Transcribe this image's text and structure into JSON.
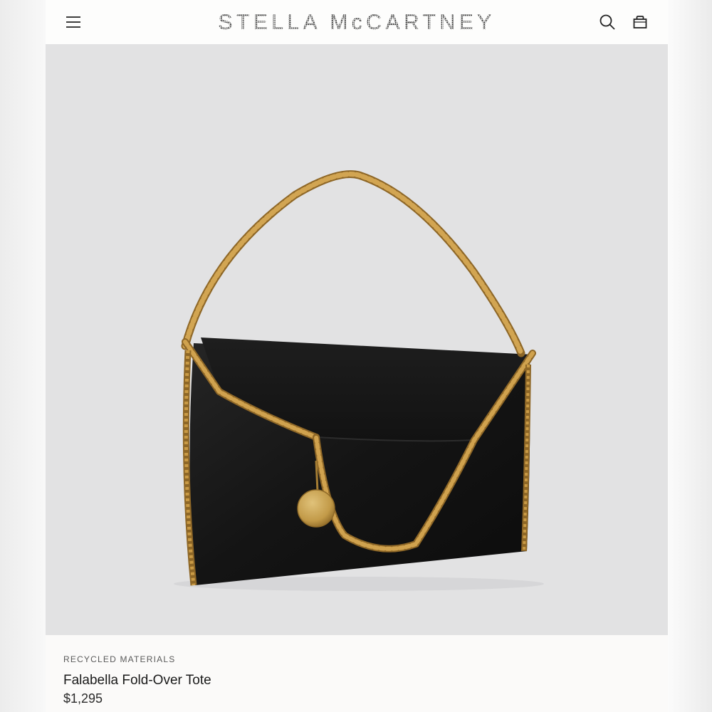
{
  "header": {
    "brand": "STELLA McCARTNEY",
    "menu_icon": "hamburger-menu-icon",
    "search_icon": "search-icon",
    "bag_icon": "shopping-bag-icon"
  },
  "product": {
    "tag": "RECYCLED MATERIALS",
    "name": "Falabella Fold-Over Tote",
    "price": "$1,295",
    "image": "black-fold-over-tote-with-gold-chain-photo"
  },
  "colors": {
    "page_background": "#fbfaf9",
    "media_background": "#e2e2e3",
    "bag_body": "#161616",
    "chain_gold": "#b98a3a",
    "text_primary": "#1a1a1a"
  }
}
